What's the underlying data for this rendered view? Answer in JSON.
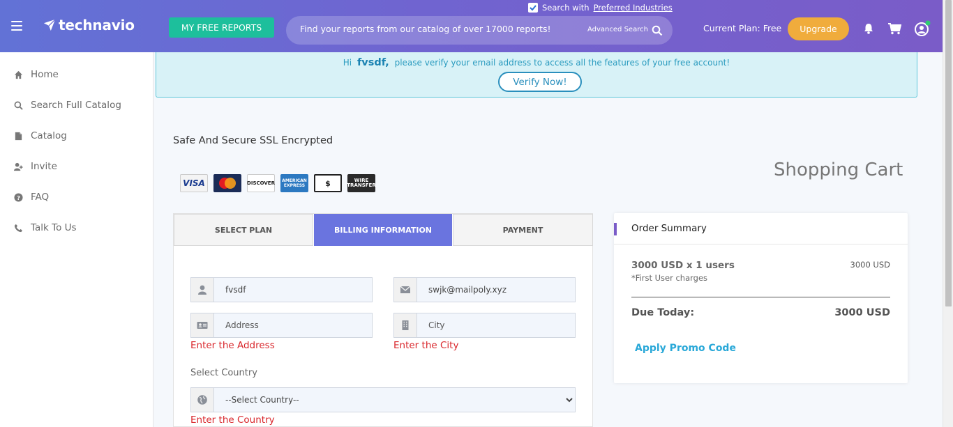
{
  "header": {
    "logo_text": "technavio",
    "free_reports_label": "MY FREE REPORTS",
    "search_placeholder": "Find your reports from our catalog of over 17000 reports!",
    "advanced_search_label": "Advanced Search",
    "preferred_prefix": "Search with",
    "preferred_link": "Preferred Industries",
    "current_plan": "Current Plan: Free",
    "upgrade_label": "Upgrade",
    "accent": "#1dbf9c",
    "upgrade_color": "#f0ac3c"
  },
  "sidebar": {
    "items": [
      {
        "label": "Home",
        "icon": "home-icon"
      },
      {
        "label": "Search Full Catalog",
        "icon": "search-icon"
      },
      {
        "label": "Catalog",
        "icon": "file-icon"
      },
      {
        "label": "Invite",
        "icon": "user-plus-icon"
      },
      {
        "label": "FAQ",
        "icon": "question-icon"
      },
      {
        "label": "Talk To Us",
        "icon": "phone-icon"
      }
    ]
  },
  "banner": {
    "greeting": "Hi",
    "username": "fvsdf,",
    "message": "please verify your email address to access all the features of your free account!",
    "verify_label": "Verify Now!"
  },
  "checkout": {
    "ssl_text": "Safe And Secure SSL Encrypted",
    "cart_title": "Shopping Cart",
    "cards": [
      "VISA",
      "MasterCard",
      "DISCOVER",
      "AMERICAN EXPRESS",
      "$",
      "WIRE TRANSFER"
    ],
    "tabs": [
      "SELECT PLAN",
      "BILLING INFORMATION",
      "PAYMENT"
    ],
    "active_tab": "BILLING INFORMATION",
    "fields": {
      "name_value": "fvsdf",
      "email_value": "swjk@mailpoly.xyz",
      "address_placeholder": "Address",
      "city_placeholder": "City",
      "address_error": "Enter the Address",
      "city_error": "Enter the City",
      "country_label": "Select Country",
      "country_selected": "--Select Country--",
      "country_error": "Enter the Country"
    }
  },
  "summary": {
    "title": "Order Summary",
    "item": "3000 USD x 1 users",
    "item_sub": "*First User charges",
    "item_amount": "3000 USD",
    "due_label": "Due Today:",
    "due_amount": "3000 USD",
    "promo_label": "Apply Promo Code"
  }
}
